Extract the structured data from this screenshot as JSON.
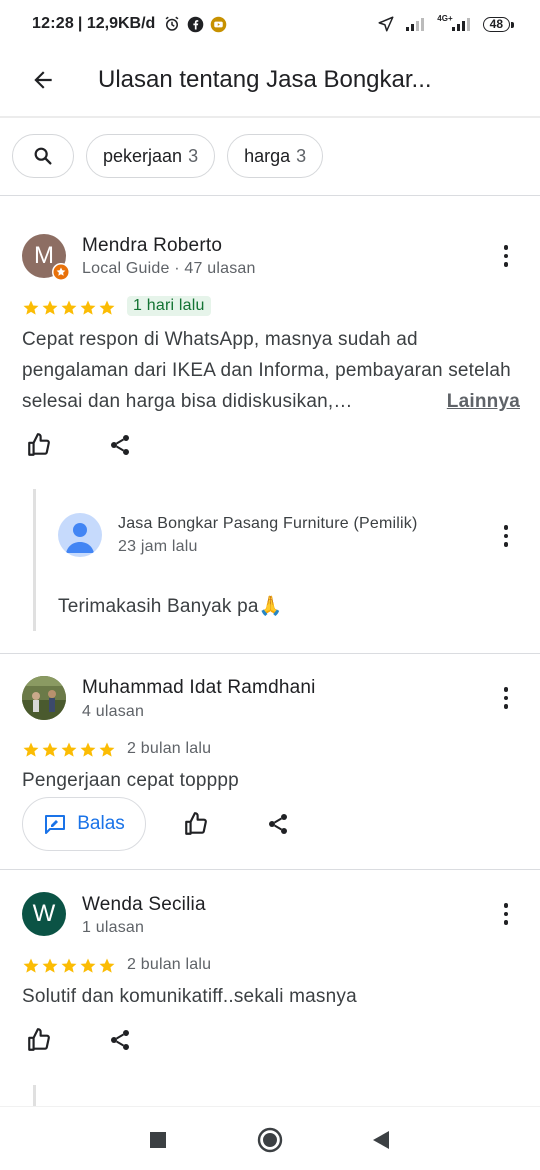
{
  "status_bar": {
    "time": "12:28",
    "speed": "| 12,9KB/d",
    "network": "4G+",
    "battery": "48"
  },
  "app_bar": {
    "title": "Ulasan tentang Jasa Bongkar..."
  },
  "filters": {
    "chips": [
      {
        "label": "pekerjaan",
        "count": "3"
      },
      {
        "label": "harga",
        "count": "3"
      }
    ]
  },
  "colors": {
    "star": "#fbbc04",
    "accent": "#1a73e8",
    "new_badge_bg": "#e6f4ea",
    "new_badge_text": "#137333"
  },
  "reviews": [
    {
      "avatar_letter": "M",
      "avatar_color": "#8d6e63",
      "name": "Mendra Roberto",
      "meta": "Local Guide · 47 ulasan",
      "rating": 5,
      "date": "1 hari lalu",
      "text": "Cepat respon di WhatsApp, masnya sudah ad pengalaman dari IKEA dan Informa, pembayaran setelah selesai dan harga bisa didiskusikan,…",
      "more_label": "Lainnya",
      "owner_reply": {
        "name": "Jasa Bongkar Pasang Furniture (Pemilik)",
        "time": "23 jam lalu",
        "text": "Terimakasih Banyak pa🙏"
      }
    },
    {
      "avatar_letter": "",
      "avatar_color": "#5d6b3c",
      "name": "Muhammad Idat Ramdhani",
      "meta": "4 ulasan",
      "rating": 5,
      "date": "2 bulan lalu",
      "text": "Pengerjaan cepat topppp",
      "reply_label": "Balas"
    },
    {
      "avatar_letter": "W",
      "avatar_color": "#0b5345",
      "name": "Wenda Secilia",
      "meta": "1 ulasan",
      "rating": 5,
      "date": "2 bulan lalu",
      "text": "Solutif  dan komunikatiff..sekali masnya"
    }
  ]
}
